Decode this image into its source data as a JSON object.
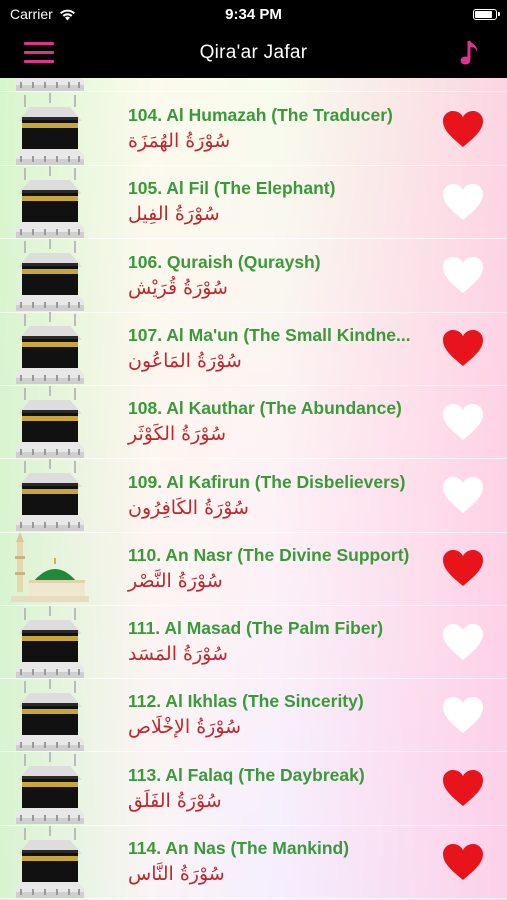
{
  "status_bar": {
    "carrier": "Carrier",
    "time": "9:34 PM"
  },
  "nav": {
    "title": "Qira'ar Jafar",
    "menu_icon": "hamburger-menu-icon",
    "music_icon": "music-note-icon"
  },
  "colors": {
    "accent": "#e0338f",
    "heart_on": "#e8141c",
    "heart_off": "#ffffff",
    "english": "#3a9a3a",
    "arabic": "#c0262c"
  },
  "surahs": [
    {
      "title": "104. Al Humazah (The Traducer)",
      "arabic": "سُوْرَةُ الهُمَزَة",
      "image": "kaaba",
      "favorite": true
    },
    {
      "title": "105. Al Fil (The Elephant)",
      "arabic": "سُوْرَةُ الفِيل",
      "image": "kaaba",
      "favorite": false
    },
    {
      "title": "106. Quraish (Quraysh)",
      "arabic": "سُوْرَةُ قُرَيْش",
      "image": "kaaba",
      "favorite": false
    },
    {
      "title": "107. Al Ma'un (The Small Kindne...",
      "arabic": "سُوْرَةُ المَاعُون",
      "image": "kaaba",
      "favorite": true
    },
    {
      "title": "108. Al Kauthar (The Abundance)",
      "arabic": "سُوْرَةُ الكَوْثَر",
      "image": "kaaba",
      "favorite": false
    },
    {
      "title": "109. Al Kafirun (The Disbelievers)",
      "arabic": "سُوْرَةُ الكَافِرُون",
      "image": "kaaba",
      "favorite": false
    },
    {
      "title": "110. An Nasr (The Divine Support)",
      "arabic": "سُوْرَةُ النَّصْر",
      "image": "green-dome",
      "favorite": true
    },
    {
      "title": "111. Al Masad (The Palm Fiber)",
      "arabic": "سُوْرَةُ المَسَد",
      "image": "kaaba",
      "favorite": false
    },
    {
      "title": "112. Al Ikhlas (The Sincerity)",
      "arabic": "سُوْرَةُ الإِخْلَاص",
      "image": "kaaba",
      "favorite": false
    },
    {
      "title": "113. Al Falaq (The Daybreak)",
      "arabic": "سُوْرَةُ الفَلَق",
      "image": "kaaba",
      "favorite": true
    },
    {
      "title": "114. An Nas (The Mankind)",
      "arabic": "سُوْرَةُ النَّاس",
      "image": "kaaba",
      "favorite": true
    }
  ]
}
